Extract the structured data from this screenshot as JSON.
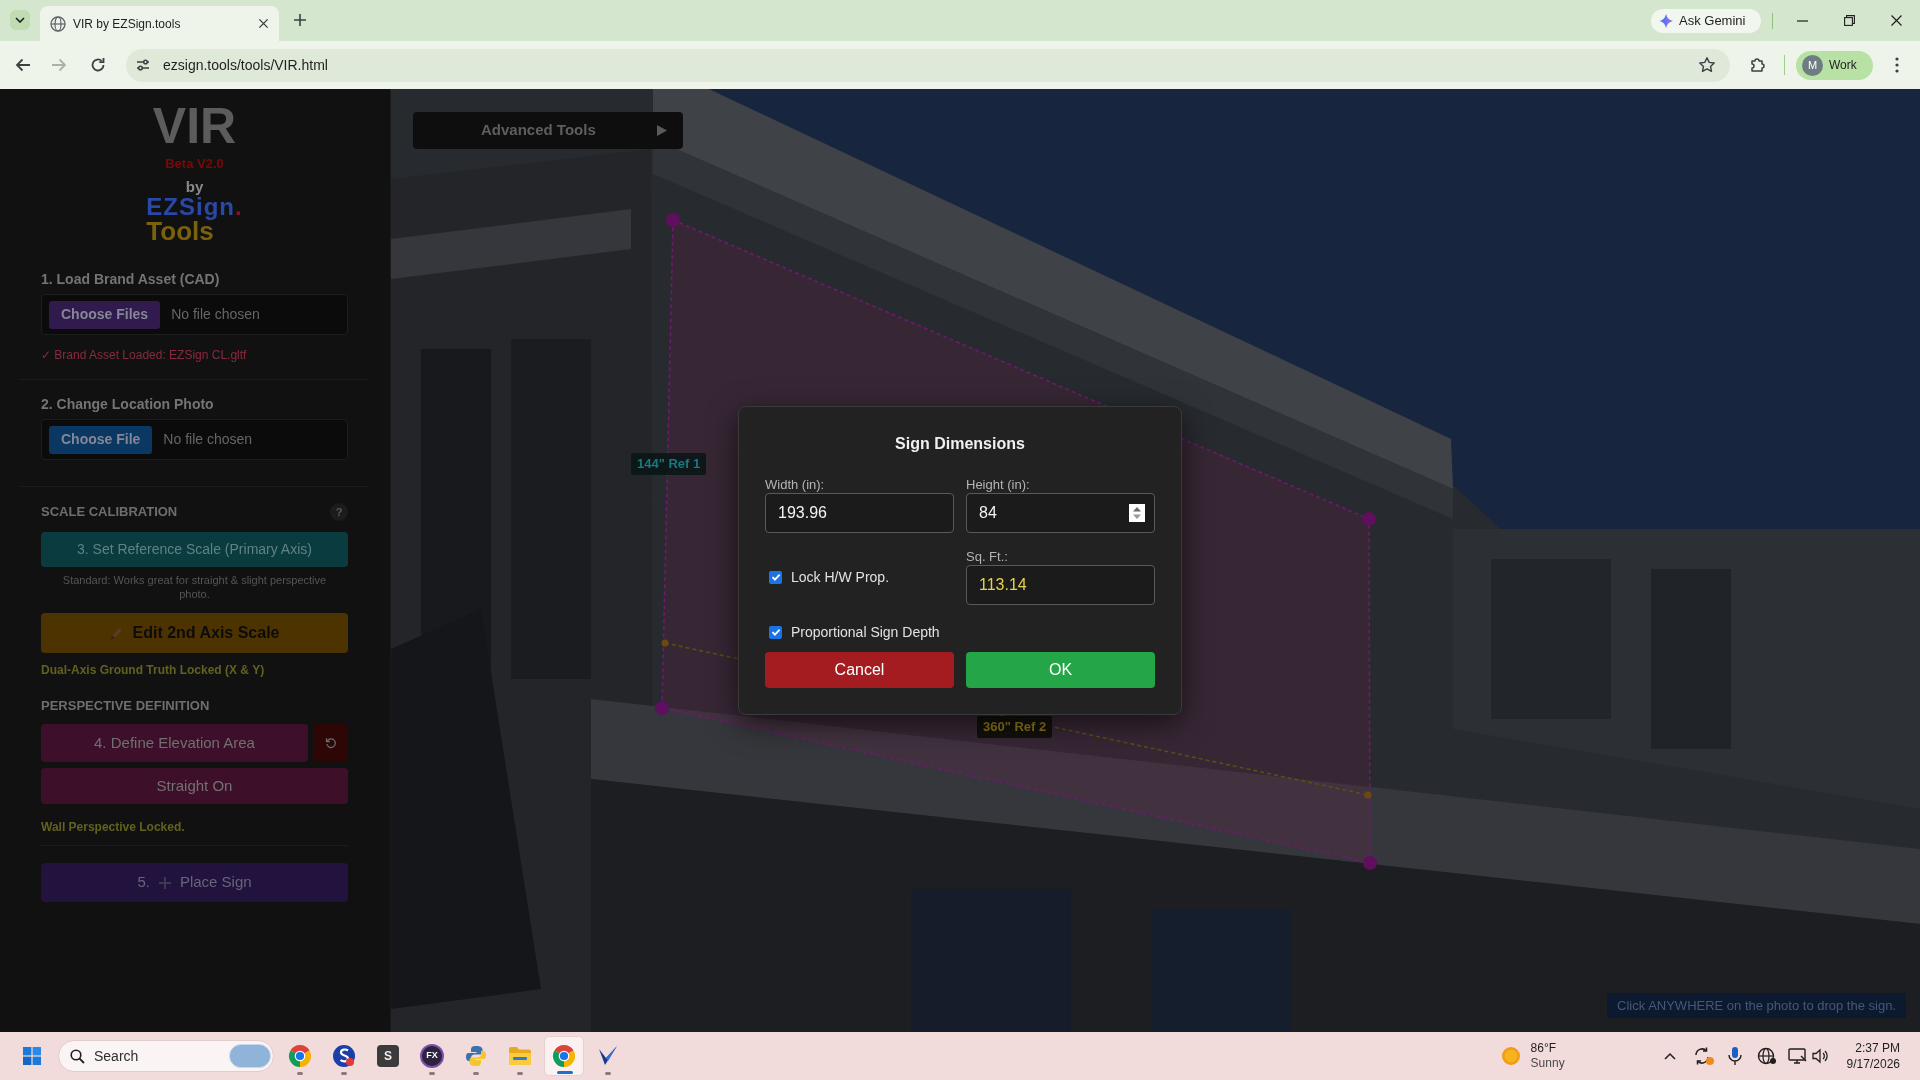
{
  "browser": {
    "tabs": [
      {
        "title": "VIR by EZSign.tools",
        "selected": true
      }
    ],
    "nav": [
      {
        "kind": "back",
        "disabled": false
      },
      {
        "kind": "forward",
        "disabled": true
      },
      {
        "kind": "reload",
        "disabled": false
      }
    ],
    "url": "ezsign.tools/tools/VIR.html",
    "assistant": "Ask Gemini",
    "profile": {
      "initial": "M",
      "label": "Work"
    }
  },
  "sidebar": {
    "logo": {
      "title": "VIR",
      "version": "Beta V2.0",
      "by": "by",
      "brand": "EZSign",
      "brand_dot": ".",
      "brand_sub": "Tools"
    },
    "uploads": [
      {
        "heading": "1. Load Brand Asset (CAD)",
        "button": "Choose Files",
        "file_status": "No file chosen",
        "color": "#301a4e",
        "message": "✓ Brand Asset Loaded: EZSign CL.gltf"
      },
      {
        "heading": "2. Change Location Photo",
        "button": "Choose File",
        "file_status": "No file chosen",
        "color": "#0b3863"
      }
    ],
    "scale": {
      "title": "SCALE CALIBRATION",
      "help": "?",
      "primary": "3. Set Reference Scale (Primary Axis)",
      "note": "Standard: Works great for straight & slight perspective photo.",
      "secondary": "Edit 2nd Axis Scale",
      "status": "Dual-Axis Ground Truth Locked (X & Y)"
    },
    "perspective": {
      "title": "PERSPECTIVE DEFINITION",
      "define": "4. Define Elevation Area",
      "mode": "Straight On",
      "status": "Wall Perspective Locked."
    },
    "place": {
      "number": "5.",
      "label": "Place Sign"
    }
  },
  "canvas": {
    "advanced_tools": {
      "label": "Advanced Tools",
      "expanded": false
    },
    "reference_labels": [
      {
        "text": "144\" Ref 1",
        "kind": "primary"
      },
      {
        "text": "360\" Ref 2",
        "kind": "secondary"
      }
    ],
    "hint": "Click ANYWHERE on the photo to drop the sign."
  },
  "dialog": {
    "title": "Sign Dimensions",
    "fields": [
      {
        "label": "Width (in):",
        "value": "193.96",
        "kind": "text"
      },
      {
        "label": "Height (in):",
        "value": "84",
        "kind": "number"
      },
      {
        "label": "Sq. Ft.:",
        "value": "113.14",
        "kind": "readout"
      }
    ],
    "checkboxes": [
      {
        "label": "Lock H/W Prop.",
        "checked": true
      },
      {
        "label": "Proportional Sign Depth",
        "checked": true
      }
    ],
    "buttons": [
      {
        "label": "Cancel",
        "kind": "cancel"
      },
      {
        "label": "OK",
        "kind": "confirm"
      }
    ]
  },
  "taskbar": {
    "search": {
      "placeholder": "Search"
    },
    "apps": [
      {
        "kind": "browser",
        "running": true,
        "selected": false
      },
      {
        "kind": "swirl",
        "running": true,
        "selected": false
      },
      {
        "kind": "tile",
        "label": "S",
        "running": false,
        "selected": false
      },
      {
        "kind": "disc",
        "label": "FX",
        "running": true,
        "selected": false
      },
      {
        "kind": "snake",
        "running": true,
        "selected": false
      },
      {
        "kind": "folder",
        "running": true,
        "selected": false
      },
      {
        "kind": "browser",
        "running": true,
        "selected": true
      },
      {
        "kind": "arrow",
        "running": true,
        "selected": false
      }
    ],
    "weather": {
      "temperature": "86°F",
      "condition": "Sunny"
    },
    "clock": {
      "time": "2:37 PM",
      "date": "9/17/2026"
    }
  }
}
